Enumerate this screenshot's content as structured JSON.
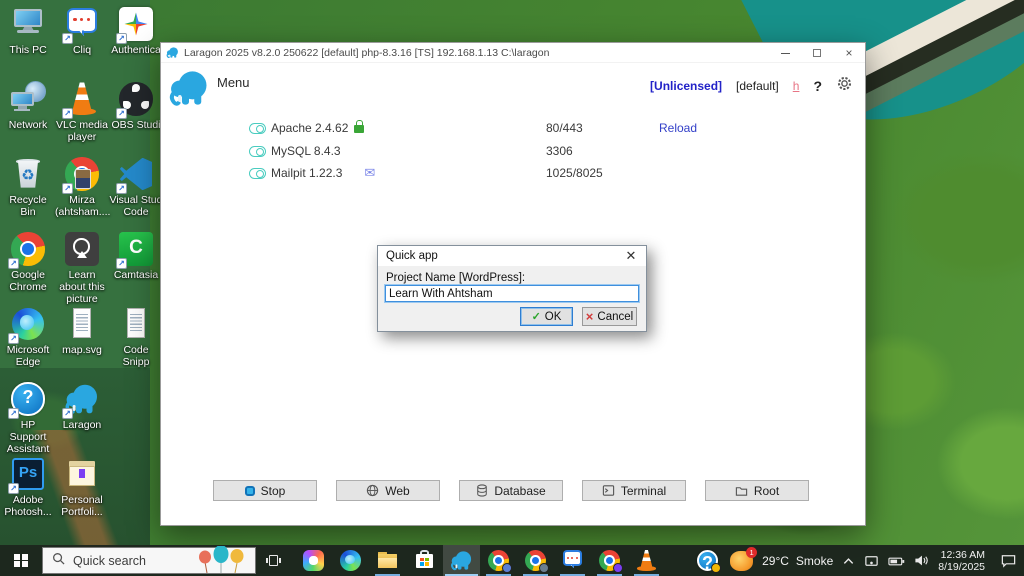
{
  "desktop": {
    "icons": [
      {
        "label": "This PC",
        "icon": "this-pc",
        "col": 0,
        "row": 0,
        "shortcut": false
      },
      {
        "label": "Cliq",
        "icon": "cliq",
        "col": 1,
        "row": 0,
        "shortcut": true
      },
      {
        "label": "Authentica",
        "icon": "authenticator",
        "col": 2,
        "row": 0,
        "shortcut": true
      },
      {
        "label": "Network",
        "icon": "network",
        "col": 0,
        "row": 1,
        "shortcut": false
      },
      {
        "label": "VLC media player",
        "icon": "vlc",
        "col": 1,
        "row": 1,
        "shortcut": true
      },
      {
        "label": "OBS Studi",
        "icon": "obs",
        "col": 2,
        "row": 1,
        "shortcut": true
      },
      {
        "label": "Recycle Bin",
        "icon": "recycle-bin",
        "col": 0,
        "row": 2,
        "shortcut": false
      },
      {
        "label": "Mirza (ahtsham....",
        "icon": "chrome-profile",
        "col": 1,
        "row": 2,
        "shortcut": true
      },
      {
        "label": "Visual Stud Code",
        "icon": "vscode",
        "col": 2,
        "row": 2,
        "shortcut": true
      },
      {
        "label": "Google Chrome",
        "icon": "chrome",
        "col": 0,
        "row": 3,
        "shortcut": true
      },
      {
        "label": "Learn about this picture",
        "icon": "info-photo",
        "col": 1,
        "row": 3,
        "shortcut": false
      },
      {
        "label": "Camtasia",
        "icon": "camtasia",
        "col": 2,
        "row": 3,
        "shortcut": true
      },
      {
        "label": "Microsoft Edge",
        "icon": "edge",
        "col": 0,
        "row": 4,
        "shortcut": true
      },
      {
        "label": "map.svg",
        "icon": "doc",
        "col": 1,
        "row": 4,
        "shortcut": false
      },
      {
        "label": "Code Snipp",
        "icon": "doc",
        "col": 2,
        "row": 4,
        "shortcut": false
      },
      {
        "label": "HP Support Assistant",
        "icon": "hp-support",
        "col": 0,
        "row": 5,
        "shortcut": true
      },
      {
        "label": "Laragon",
        "icon": "laragon",
        "col": 1,
        "row": 5,
        "shortcut": true
      },
      {
        "label": "Adobe Photosh...",
        "icon": "photoshop",
        "col": 0,
        "row": 6,
        "shortcut": true
      },
      {
        "label": "Personal Portfoli...",
        "icon": "folder-portfolio",
        "col": 1,
        "row": 6,
        "shortcut": false
      }
    ]
  },
  "laragon": {
    "titlebar": {
      "title": "Laragon 2025 v8.2.0 250622 [default] php-8.3.16 [TS]  192.168.1.13 C:\\laragon"
    },
    "header": {
      "menu": "Menu",
      "license": "[Unlicensed]",
      "profile": "[default]",
      "hotkey": "h",
      "help": "?"
    },
    "services": [
      {
        "name": "Apache 2.4.62",
        "ports": "80/443",
        "action": "Reload",
        "extra": "lock"
      },
      {
        "name": "MySQL 8.4.3",
        "ports": "3306",
        "action": "",
        "extra": ""
      },
      {
        "name": "Mailpit 1.22.3",
        "ports": "1025/8025",
        "action": "",
        "extra": "mail"
      }
    ],
    "footer_buttons": [
      {
        "label": "Stop",
        "icon": "stop"
      },
      {
        "label": "Web",
        "icon": "globe"
      },
      {
        "label": "Database",
        "icon": "database"
      },
      {
        "label": "Terminal",
        "icon": "terminal"
      },
      {
        "label": "Root",
        "icon": "folder"
      }
    ]
  },
  "dialog": {
    "title": "Quick app",
    "field_label": "Project Name [WordPress]:",
    "value": "Learn With Ahtsham",
    "ok": "OK",
    "cancel": "Cancel"
  },
  "taskbar": {
    "search": "Quick search",
    "apps": [
      {
        "icon": "copilot",
        "running": false,
        "active": false,
        "badge": ""
      },
      {
        "icon": "edge",
        "running": false,
        "active": false,
        "badge": ""
      },
      {
        "icon": "explorer",
        "running": true,
        "active": false,
        "badge": ""
      },
      {
        "icon": "store",
        "running": false,
        "active": false,
        "badge": ""
      },
      {
        "icon": "laragon",
        "running": true,
        "active": true,
        "badge": ""
      },
      {
        "icon": "chrome",
        "running": true,
        "active": false,
        "badge": "#5b7fd4"
      },
      {
        "icon": "chrome",
        "running": true,
        "active": false,
        "badge": "#6b7f8f"
      },
      {
        "icon": "cliq",
        "running": true,
        "active": false,
        "badge": ""
      },
      {
        "icon": "chrome",
        "running": true,
        "active": false,
        "badge": "#7b3ff2"
      },
      {
        "icon": "vlc",
        "running": true,
        "active": false,
        "badge": ""
      },
      {
        "icon": "hp-support",
        "running": false,
        "active": false,
        "badge": "#f2b705",
        "gap": 24
      }
    ],
    "tray": {
      "weather_badge": "1",
      "temperature": "29°C",
      "condition": "Smoke",
      "time": "12:36 AM",
      "date": "8/19/2025"
    }
  },
  "colors": {
    "accent": "#2e7dd1",
    "license_text": "#2323c8",
    "reload_link": "#3340c8",
    "toggle": "#49ccbf",
    "lock": "#3aa637",
    "taskbar_underline": "#76aede"
  }
}
